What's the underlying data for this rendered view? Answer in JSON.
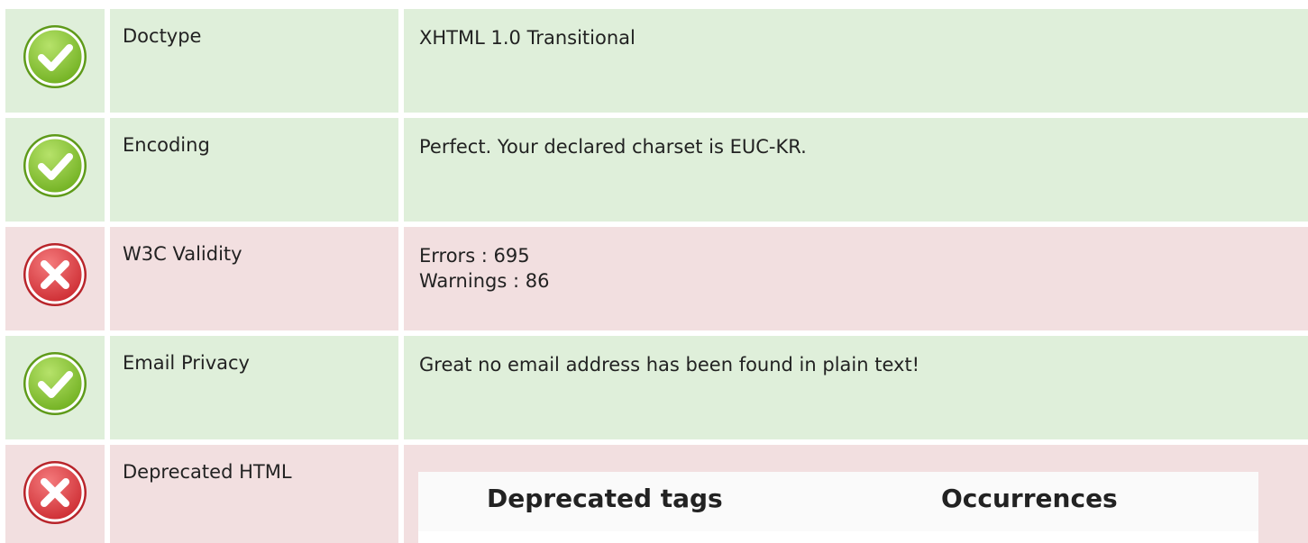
{
  "rows": [
    {
      "status": "ok",
      "icon": "check-circle-icon",
      "label": "Doctype",
      "values": [
        "XHTML 1.0 Transitional"
      ]
    },
    {
      "status": "ok",
      "icon": "check-circle-icon",
      "label": "Encoding",
      "values": [
        "Perfect. Your declared charset is EUC-KR."
      ]
    },
    {
      "status": "error",
      "icon": "x-circle-icon",
      "label": "W3C Validity",
      "values": [
        "Errors : 695",
        "Warnings : 86"
      ]
    },
    {
      "status": "ok",
      "icon": "check-circle-icon",
      "label": "Email Privacy",
      "values": [
        "Great no email address has been found in plain text!"
      ]
    },
    {
      "status": "error",
      "icon": "x-circle-icon",
      "label": "Deprecated HTML",
      "table": {
        "headers": [
          "Deprecated tags",
          "Occurrences"
        ]
      }
    }
  ],
  "colors": {
    "ok_background": "#dfefda",
    "error_background": "#f2dfe0",
    "ok_icon": "#8cc63f",
    "error_icon": "#e0383e"
  }
}
